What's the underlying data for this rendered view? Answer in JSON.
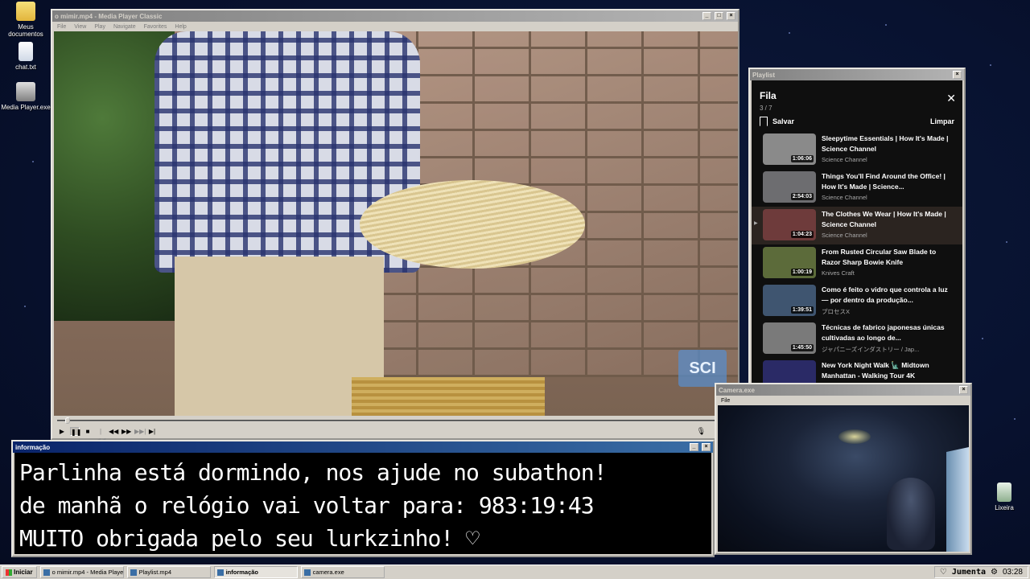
{
  "desktop": {
    "icons": [
      {
        "label": "Meus documentos",
        "icon": "folder-icon"
      },
      {
        "label": "chat.txt",
        "icon": "text-file-icon"
      },
      {
        "label": "Media Player.exe",
        "icon": "app-icon"
      },
      {
        "label": "Lixeira",
        "icon": "recycle-bin-icon"
      }
    ]
  },
  "player": {
    "title": "o mimir.mp4 - Media Player Classic",
    "menu": [
      "File",
      "View",
      "Play",
      "Navigate",
      "Favorites",
      "Help"
    ],
    "watermark": "SCI",
    "controls": {
      "play": "▶",
      "pause": "❚❚",
      "stop": "■",
      "prev": "|◀◀",
      "rewind": "◀◀",
      "forward": "▶▶",
      "next": "▶▶|",
      "step": "▶|",
      "volume": "🎙"
    },
    "progress": 0.01
  },
  "playlist": {
    "window_title": "Playlist",
    "heading": "Fila",
    "count": "3 / 7",
    "save_label": "Salvar",
    "clear_label": "Limpar",
    "items": [
      {
        "title": "Sleepytime Essentials | How It's Made | Science Channel",
        "channel": "Science Channel",
        "duration": "1:06:06",
        "thumb_color": "#8a8a8a",
        "current": false
      },
      {
        "title": "Things You'll Find Around the Office! | How It's Made | Science...",
        "channel": "Science Channel",
        "duration": "2:54:03",
        "thumb_color": "#6d6d70",
        "current": false
      },
      {
        "title": "The Clothes We Wear | How It's Made | Science Channel",
        "channel": "Science Channel",
        "duration": "1:04:23",
        "thumb_color": "#6e3b3b",
        "current": true
      },
      {
        "title": "From Rusted Circular Saw Blade to Razor Sharp Bowie Knife",
        "channel": "Knives Craft",
        "duration": "1:00:19",
        "thumb_color": "#5c6b3a",
        "current": false
      },
      {
        "title": "Como é feito o vidro que controla a luz — por dentro da produção...",
        "channel": "プロセスX",
        "duration": "1:39:51",
        "thumb_color": "#3f5570",
        "current": false
      },
      {
        "title": "Técnicas de fabrico japonesas únicas cultivadas ao longo de...",
        "channel": "ジャパニーズインダストリー / Jap...",
        "duration": "1:45:50",
        "thumb_color": "#7a7a7a",
        "current": false
      },
      {
        "title": "New York Night Walk 🗽 Midtown Manhattan - Walking Tour 4K",
        "channel": "",
        "duration": "",
        "thumb_color": "#2a2a66",
        "current": false
      }
    ]
  },
  "info": {
    "window_title": "informação",
    "lines": [
      "Parlinha está dormindo, nos ajude no subathon!",
      "de manhã o relógio vai voltar para:  983:19:43",
      "MUITO obrigada pelo seu lurkzinho! ♡"
    ]
  },
  "camera": {
    "window_title": "Camera.exe",
    "menu": [
      "File"
    ]
  },
  "taskbar": {
    "start_label": "Iniciar",
    "tasks": [
      {
        "label": "o mimir.mp4 - Media Playe...",
        "active": false
      },
      {
        "label": "Playlist.mp4",
        "active": false
      },
      {
        "label": "informação",
        "active": true
      },
      {
        "label": "camera.exe",
        "active": false
      }
    ],
    "tray_user": "Jumenta",
    "clock": "03:28"
  }
}
